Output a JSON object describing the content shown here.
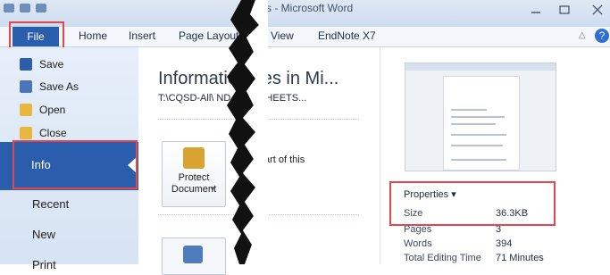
{
  "window": {
    "title": "s - Microsoft Word"
  },
  "ribbon": {
    "tabs": [
      "File",
      "Home",
      "Insert",
      "Page Layout",
      "View",
      "EndNote X7"
    ]
  },
  "backstage": {
    "top_items": [
      {
        "label": "Save",
        "icon": "save-icon"
      },
      {
        "label": "Save As",
        "icon": "save-as-icon"
      },
      {
        "label": "Open",
        "icon": "open-folder-icon"
      },
      {
        "label": "Close",
        "icon": "close-folder-icon"
      }
    ],
    "selected": "Info",
    "other_items": [
      "Recent",
      "New",
      "Print"
    ]
  },
  "info": {
    "title": "Informatio   ages in Mi...",
    "path": "T:\\CQSD-All\\          ND HELPSHEETS...",
    "protect_label_line1": "Protect",
    "protect_label_line2": "Document",
    "protect_desc": "art of this"
  },
  "properties": {
    "header": "Properties ▾",
    "rows": [
      {
        "key": "Size",
        "value": "36.3KB"
      },
      {
        "key": "Pages",
        "value": "3"
      },
      {
        "key": "Words",
        "value": "394"
      },
      {
        "key": "Total Editing Time",
        "value": "71 Minutes"
      }
    ]
  },
  "colors": {
    "accent": "#2a5dab",
    "highlight": "#e1474d"
  }
}
